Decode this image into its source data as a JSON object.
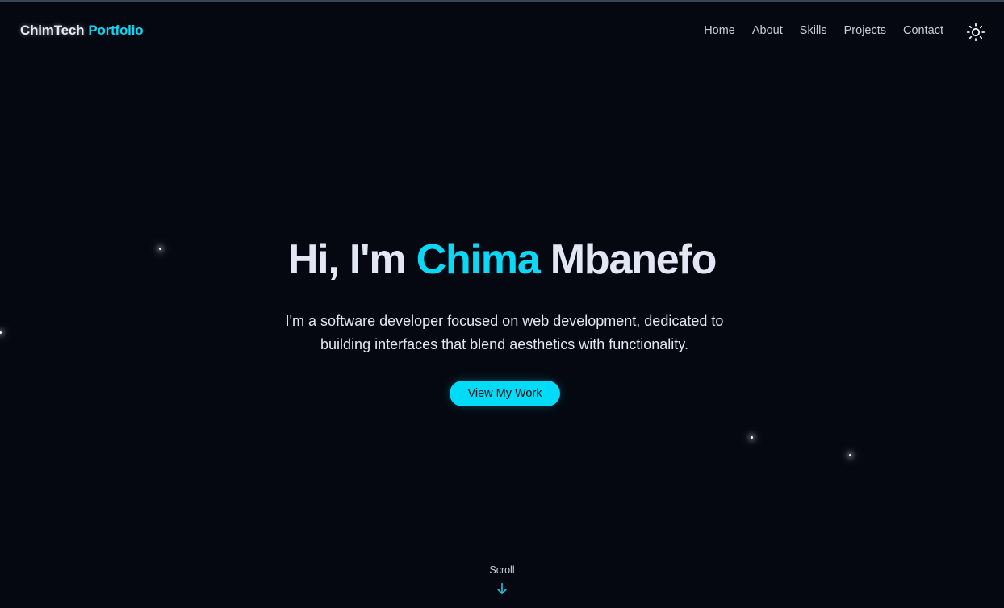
{
  "brand": {
    "name_part1": "ChimTech",
    "name_part2": "Portfolio"
  },
  "nav": {
    "items": [
      {
        "label": "Home"
      },
      {
        "label": "About"
      },
      {
        "label": "Skills"
      },
      {
        "label": "Projects"
      },
      {
        "label": "Contact"
      }
    ],
    "theme_toggle_icon": "sun-icon"
  },
  "hero": {
    "title_prefix": "Hi, I'm",
    "title_highlight": "Chima",
    "title_suffix": "Mbanefo",
    "subtitle": "I'm a software developer focused on web development, dedicated to building interfaces that blend aesthetics with functionality.",
    "cta_label": "View My Work"
  },
  "scroll": {
    "label": "Scroll",
    "icon": "arrow-down-icon"
  },
  "colors": {
    "background": "#050810",
    "accent": "#0ad8f5",
    "text": "#e3e7f3"
  }
}
